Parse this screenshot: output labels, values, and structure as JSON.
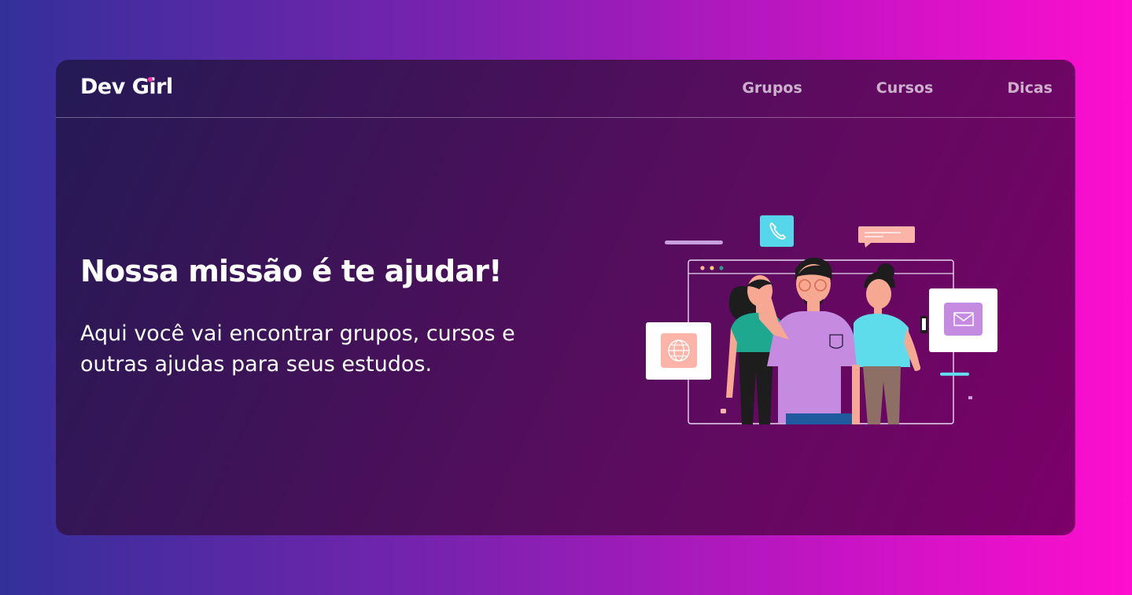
{
  "app": {
    "brand": "Dev Girl",
    "brand_accent_color": "#ff2fb8"
  },
  "nav": {
    "items": [
      {
        "label": "Grupos"
      },
      {
        "label": "Cursos"
      },
      {
        "label": "Dicas"
      }
    ]
  },
  "hero": {
    "title": "Nossa missão é te ajudar!",
    "subtitle": "Aqui você vai encontrar grupos, cursos e outras ajudas para seus estudos."
  },
  "illustration": {
    "icons": [
      "phone-icon",
      "chat-bubble-icon",
      "globe-icon",
      "mail-icon"
    ]
  }
}
